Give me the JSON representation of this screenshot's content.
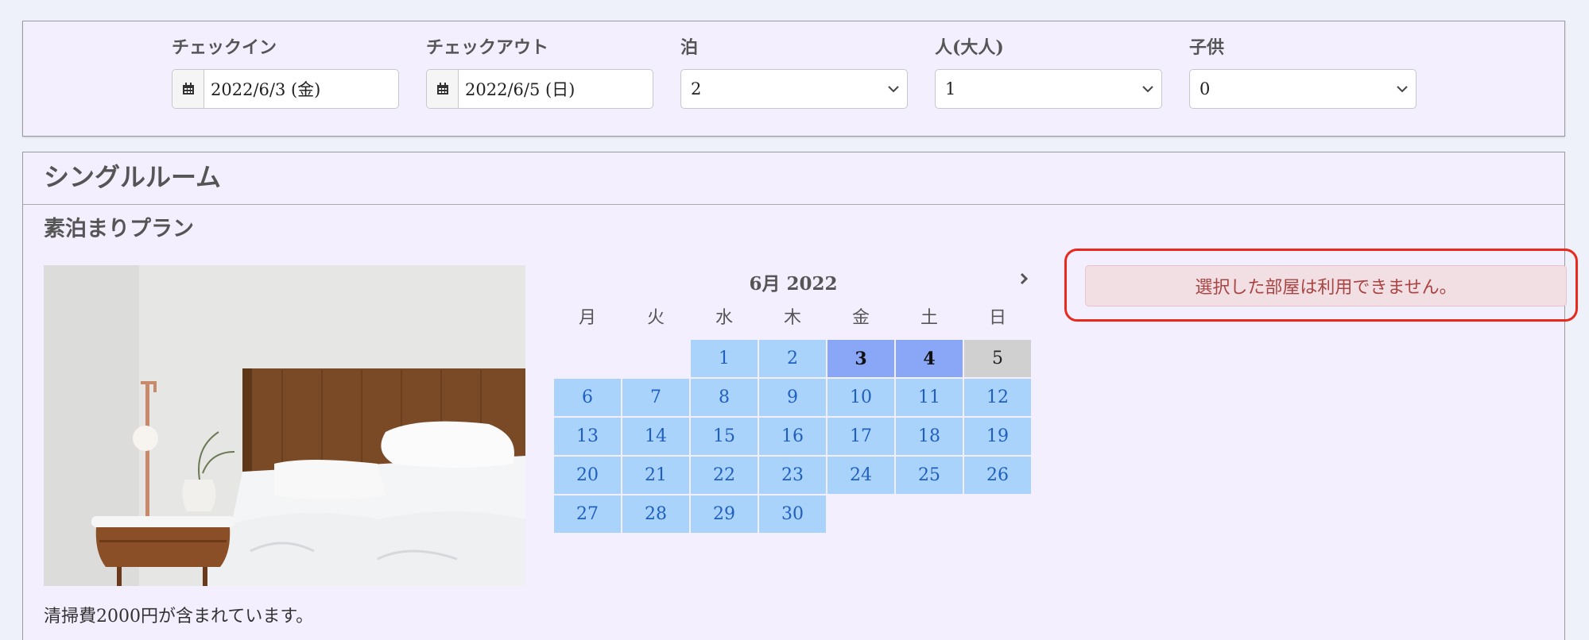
{
  "search": {
    "checkin": {
      "label": "チェックイン",
      "value": "2022/6/3 (金)"
    },
    "checkout": {
      "label": "チェックアウト",
      "value": "2022/6/5 (日)"
    },
    "nights": {
      "label": "泊",
      "value": "2"
    },
    "adults": {
      "label": "人(大人)",
      "value": "1"
    },
    "children": {
      "label": "子供",
      "value": "0"
    }
  },
  "room": {
    "title": "シングルルーム",
    "plan_title": "素泊まりプラン",
    "fee_note": "清掃費2000円が含まれています。"
  },
  "calendar": {
    "month_label": "6月 2022",
    "weekdays": [
      "月",
      "火",
      "水",
      "木",
      "金",
      "土",
      "日"
    ],
    "leading_blanks": 2,
    "days": [
      "1",
      "2",
      "3",
      "4",
      "5",
      "6",
      "7",
      "8",
      "9",
      "10",
      "11",
      "12",
      "13",
      "14",
      "15",
      "16",
      "17",
      "18",
      "19",
      "20",
      "21",
      "22",
      "23",
      "24",
      "25",
      "26",
      "27",
      "28",
      "29",
      "30"
    ],
    "checkin_day": "3",
    "stay_days": [
      "4"
    ],
    "checkout_day": "5"
  },
  "alert": {
    "message": "選択した部屋は利用できません。"
  },
  "colors": {
    "available": "#a9d3fb",
    "selected": "#8aa6f6",
    "checkout": "#d0d0d0",
    "alert_bg": "#f1dfe4",
    "alert_text": "#a94442",
    "highlight": "#e8291c"
  }
}
